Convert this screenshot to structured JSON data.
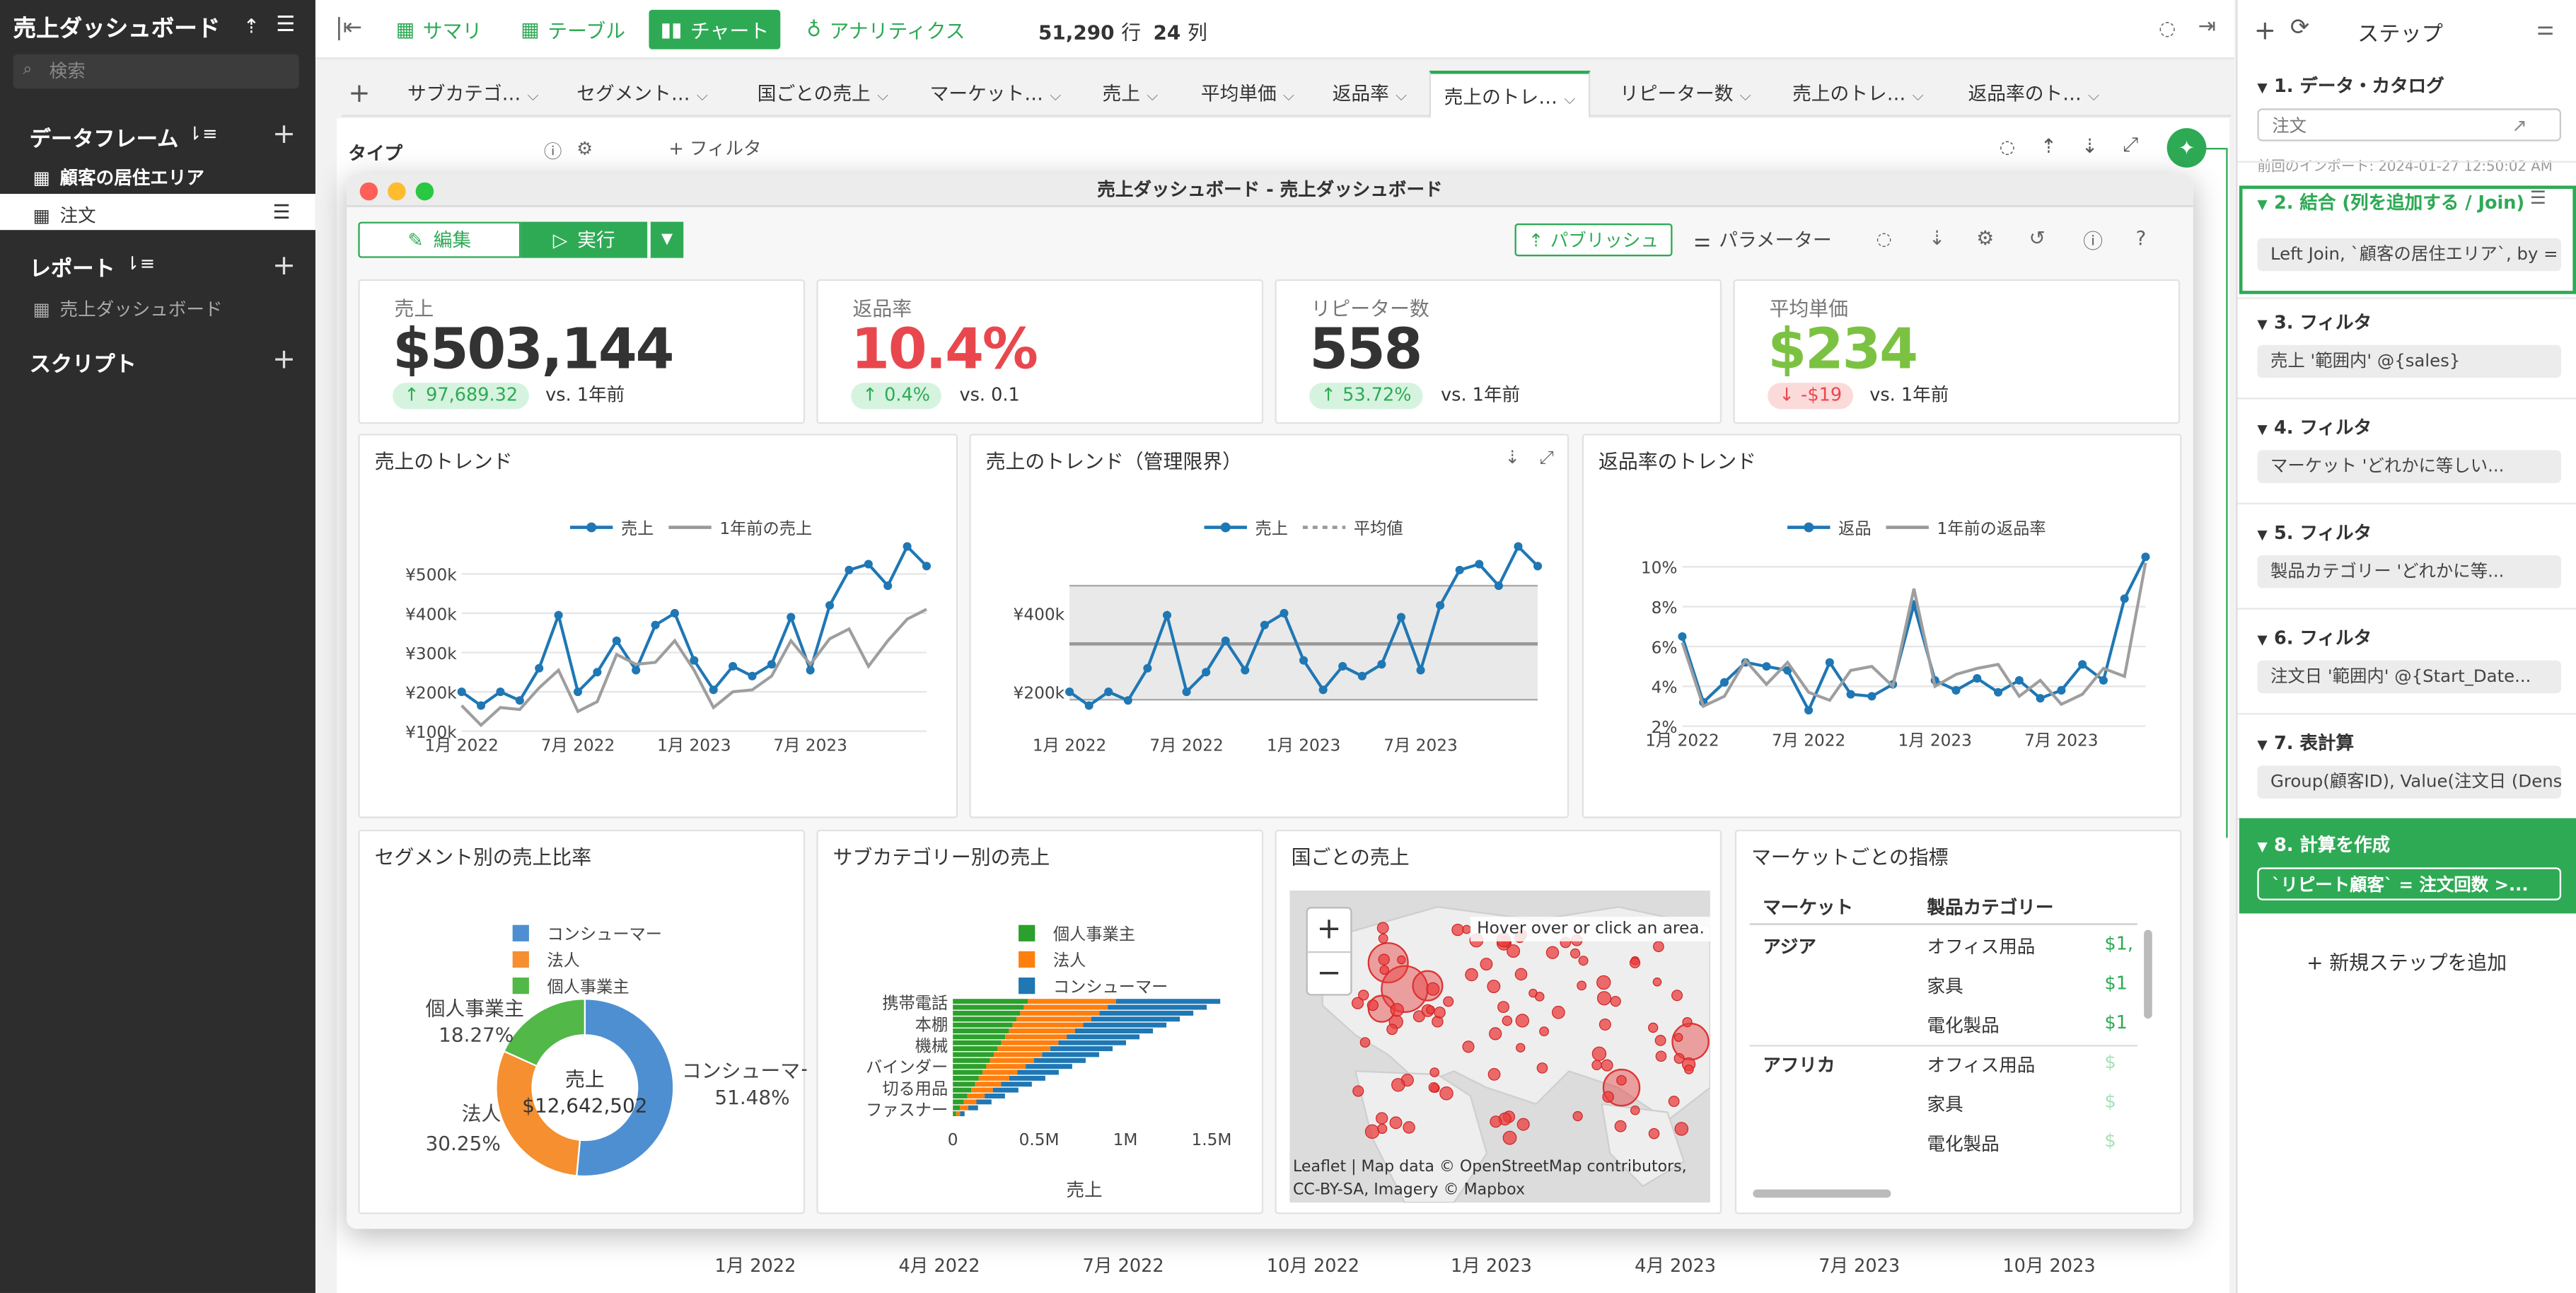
{
  "app": {
    "title": "売上ダッシュボード",
    "search_placeholder": "検索"
  },
  "sidebar": {
    "dataframes_label": "データフレーム",
    "df_items": [
      "顧客の居住エリア",
      "注文"
    ],
    "reports_label": "レポート",
    "report_items": [
      "売上ダッシュボード"
    ],
    "scripts_label": "スクリプト"
  },
  "topbar": {
    "summary": "サマリ",
    "table": "テーブル",
    "chart": "チャート",
    "analytics": "アナリティクス",
    "rows": "51,290",
    "rows_unit": "行",
    "cols": "24",
    "cols_unit": "列"
  },
  "tabs": [
    "サブカテゴ…",
    "セグメント…",
    "国ごとの売上",
    "マーケット…",
    "売上",
    "平均単価",
    "返品率",
    "売上のトレ…",
    "リピーター数",
    "売上のトレ…",
    "返品率のト…"
  ],
  "behind": {
    "type_label": "タイプ",
    "filter_label": "フィルタ",
    "x_ticks": [
      "1月 2022",
      "4月 2022",
      "7月 2022",
      "10月 2022",
      "1月 2023",
      "4月 2023",
      "7月 2023",
      "10月 2023"
    ]
  },
  "steps_panel": {
    "title": "ステップ",
    "steps": [
      {
        "h": "1. データ・カタログ",
        "b": "注文",
        "note": "前回のインポート: 2024-01-27 12:50:02 AM"
      },
      {
        "h": "2. 結合 (列を追加する / Join)",
        "b": "Left Join, `顧客の居住エリア`, by = j..."
      },
      {
        "h": "3. フィルタ",
        "b": "売上 '範囲内' @{sales}"
      },
      {
        "h": "4. フィルタ",
        "b": "マーケット 'どれかに等しい..."
      },
      {
        "h": "5. フィルタ",
        "b": "製品カテゴリー 'どれかに等..."
      },
      {
        "h": "6. フィルタ",
        "b": "注文日 '範囲内' @{Start_Date..."
      },
      {
        "h": "7. 表計算",
        "b": "Group(顧客ID), Value(注文日 (Dense..."
      },
      {
        "h": "8. 計算を作成",
        "b": "`リピート顧客` = 注文回数 >..."
      }
    ],
    "add_step": "新規ステップを追加"
  },
  "modal": {
    "title": "売上ダッシュボード - 売上ダッシュボード",
    "edit": "編集",
    "run": "実行",
    "publish": "パブリッシュ",
    "params": "パラメーター",
    "kpis": [
      {
        "label": "売上",
        "value": "$503,144",
        "delta": "97,689.32",
        "vs": "vs. 1年前",
        "color": "#333333",
        "delta_up": true
      },
      {
        "label": "返品率",
        "value": "10.4%",
        "delta": "0.4%",
        "vs": "vs. 0.1",
        "color": "#e8484d",
        "delta_up": true
      },
      {
        "label": "リピーター数",
        "value": "558",
        "delta": "53.72%",
        "vs": "vs. 1年前",
        "color": "#333333",
        "delta_up": true
      },
      {
        "label": "平均単価",
        "value": "$234",
        "delta": "-$19",
        "vs": "vs. 1年前",
        "color": "#7cc242",
        "delta_up": false
      }
    ]
  },
  "chart_data": [
    {
      "type": "line",
      "title": "売上のトレンド",
      "x": [
        "1月 2022",
        "7月 2022",
        "1月 2023",
        "7月 2023"
      ],
      "y_ticks": [
        "¥100k",
        "¥200k",
        "¥300k",
        "¥400k",
        "¥500k"
      ],
      "ylim": [
        100000,
        560000
      ],
      "series": [
        {
          "name": "売上",
          "values": [
            200000,
            165000,
            200000,
            178000,
            260000,
            395000,
            200000,
            250000,
            330000,
            255000,
            370000,
            400000,
            280000,
            205000,
            265000,
            240000,
            270000,
            390000,
            255000,
            420000,
            510000,
            525000,
            470000,
            570000,
            520000
          ]
        },
        {
          "name": "1年前の売上",
          "values": [
            165000,
            115000,
            160000,
            155000,
            210000,
            255000,
            150000,
            175000,
            295000,
            270000,
            275000,
            330000,
            255000,
            160000,
            200000,
            205000,
            240000,
            330000,
            270000,
            335000,
            360000,
            265000,
            330000,
            385000,
            410000
          ]
        }
      ]
    },
    {
      "type": "line",
      "title": "売上のトレンド（管理限界）",
      "x": [
        "1月 2022",
        "7月 2022",
        "1月 2023",
        "7月 2023"
      ],
      "y_ticks": [
        "¥200k",
        "¥400k"
      ],
      "ylim": [
        100000,
        560000
      ],
      "series": [
        {
          "name": "売上",
          "values": [
            200000,
            165000,
            200000,
            178000,
            260000,
            395000,
            200000,
            250000,
            330000,
            255000,
            370000,
            400000,
            280000,
            205000,
            265000,
            240000,
            270000,
            390000,
            255000,
            420000,
            510000,
            525000,
            470000,
            570000,
            520000
          ]
        },
        {
          "name": "平均値",
          "values": [
            322000
          ]
        }
      ]
    },
    {
      "type": "line",
      "title": "返品率のトレンド",
      "x": [
        "1月 2022",
        "7月 2022",
        "1月 2023",
        "7月 2023"
      ],
      "y_ticks": [
        "2%",
        "4%",
        "6%",
        "8%",
        "10%"
      ],
      "ylim": [
        2,
        10
      ],
      "series": [
        {
          "name": "返品",
          "values": [
            6.5,
            3.2,
            4.2,
            5.2,
            5.0,
            4.8,
            2.8,
            5.2,
            3.6,
            3.5,
            4.1,
            8.1,
            4.3,
            3.8,
            4.4,
            3.7,
            4.3,
            3.4,
            3.8,
            5.1,
            4.3,
            8.4,
            10.5
          ]
        },
        {
          "name": "1年前の返品率",
          "values": [
            6.2,
            3.0,
            3.5,
            5.3,
            4.1,
            5.2,
            3.7,
            3.3,
            4.8,
            5.0,
            4.0,
            8.9,
            4.0,
            4.6,
            4.9,
            5.1,
            3.5,
            4.3,
            3.1,
            3.6,
            4.9,
            4.5,
            10.2
          ]
        }
      ]
    },
    {
      "type": "pie",
      "title": "セグメント別の売上比率",
      "center_label": "売上",
      "center_value": "$12,642,502",
      "slices": [
        {
          "name": "コンシューマー",
          "value": 51.48,
          "label": "51.48%",
          "color": "#4e8fd1"
        },
        {
          "name": "法人",
          "value": 30.25,
          "label": "30.25%",
          "color": "#f58f2f"
        },
        {
          "name": "個人事業主",
          "value": 18.27,
          "label": "18.27%",
          "color": "#52b848"
        }
      ]
    },
    {
      "type": "bar",
      "title": "サブカテゴリー別の売上",
      "ylabel_x": "売上",
      "categories": [
        "携帯電話",
        "本棚",
        "機械",
        "バインダー",
        "切る用品",
        "ファスナー"
      ],
      "x_ticks": [
        "0",
        "0.5M",
        "1M",
        "1.5M"
      ],
      "series": [
        {
          "name": "個人事業主",
          "color": "#2ca02c"
        },
        {
          "name": "法人",
          "color": "#ff7f0e"
        },
        {
          "name": "コンシューマー",
          "color": "#1f77b4"
        }
      ]
    },
    {
      "type": "map",
      "title": "国ごとの売上",
      "hover": "Hover over or click an area.",
      "attribution": "Leaflet | Map data © OpenStreetMap contributors, CC-BY-SA, Imagery © Mapbox"
    },
    {
      "type": "table",
      "title": "マーケットごとの指標",
      "columns": [
        "マーケット",
        "製品カテゴリー"
      ],
      "rows": [
        [
          "アジア",
          "オフィス用品",
          "$1,"
        ],
        [
          "",
          "家具",
          "$1"
        ],
        [
          "",
          "電化製品",
          "$1"
        ],
        [
          "アフリカ",
          "オフィス用品",
          "$"
        ],
        [
          "",
          "家具",
          "$"
        ],
        [
          "",
          "電化製品",
          "$"
        ]
      ]
    }
  ]
}
